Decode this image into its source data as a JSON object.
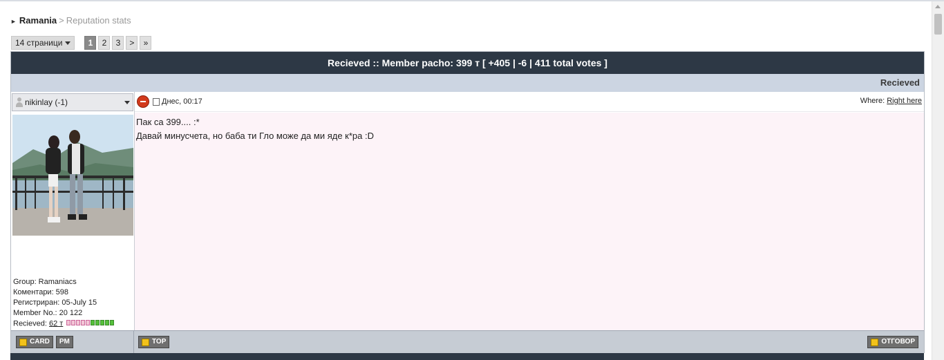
{
  "breadcrumb": {
    "home": "Ramania",
    "separator": ">",
    "current": "Reputation stats"
  },
  "pager": {
    "dropdown_label": "14 страници",
    "pages": [
      "1",
      "2",
      "3"
    ],
    "active_page": "1",
    "next": ">",
    "last": "»"
  },
  "table": {
    "title": "Recieved :: Member pacho: 399 т [ +405 | -6 | 411 total votes ]",
    "subheader": "Recieved"
  },
  "post": {
    "username": "nikinlay (-1)",
    "date": "Днес, 00:17",
    "where_label": "Where:",
    "where_link": "Right here",
    "message_lines": [
      "Пак са 399.... :*",
      "Давай минусчета, но баба ти Гло може да ми яде к*ра :D"
    ],
    "info": {
      "group": "Group: Ramaniacs",
      "comments": "Коментари: 598",
      "registered": "Регистриран: 05-July 15",
      "member_no": "Member No.: 20 122",
      "recieved_label": "Recieved:",
      "recieved_value": "62 т"
    }
  },
  "buttons": {
    "card": "CARD",
    "pm": "PM",
    "top": "TOP",
    "reply": "ОТГОВОР"
  },
  "icons": {
    "user": "user-icon",
    "rep_minus": "minus-circle-icon",
    "doc": "document-icon",
    "dropdown": "chevron-down-icon"
  },
  "colors": {
    "title_bar": "#2d3845",
    "subheader": "#ccd5e2",
    "post_bg": "#fdf3f8",
    "footer": "#c6ccd4"
  }
}
